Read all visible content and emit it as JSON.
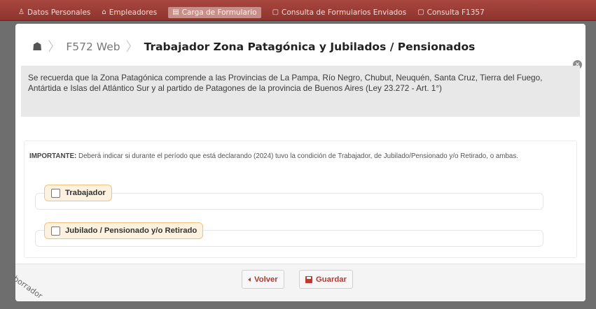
{
  "nav": {
    "tabs": [
      {
        "label": "Datos Personales",
        "icon": "user-icon"
      },
      {
        "label": "Empleadores",
        "icon": "bank-icon"
      },
      {
        "label": "Carga de Formulario",
        "icon": "form-icon",
        "active": true
      },
      {
        "label": "Consulta de Formularios Enviados",
        "icon": "list-icon"
      },
      {
        "label": "Consulta F1357",
        "icon": "list-icon"
      }
    ]
  },
  "breadcrumb": {
    "home_icon": "home-icon",
    "section": "F572 Web",
    "title": "Trabajador Zona Patagónica y Jubilados / Pensionados"
  },
  "info_text": "Se recuerda que la Zona Patagónica comprende a las Provincias de La Pampa, Río Negro, Chubut, Neuquén, Santa Cruz, Tierra del Fuego, Antártida e Islas del Atlántico Sur y al partido de Patagones de la provincia de Buenos Aires (Ley 23.272 - Art. 1°)",
  "important": {
    "label": "IMPORTANTE:",
    "text": " Deberá indicar si durante el período que está declarando (2024) tuvo la condición de Trabajador, de Jubilado/Pensionado y/o Retirado, o ambas."
  },
  "options": {
    "trabajador": {
      "label": "Trabajador",
      "checked": false
    },
    "jubilado": {
      "label": "Jubilado / Pensionado y/o Retirado",
      "checked": false
    }
  },
  "footer": {
    "back_label": "Volver",
    "save_label": "Guardar"
  },
  "watermark": "borrador",
  "colors": {
    "brand": "#9a3b34",
    "accent": "#c0392b",
    "legend_bg": "#fdf2df",
    "legend_border": "#f1c37f"
  }
}
